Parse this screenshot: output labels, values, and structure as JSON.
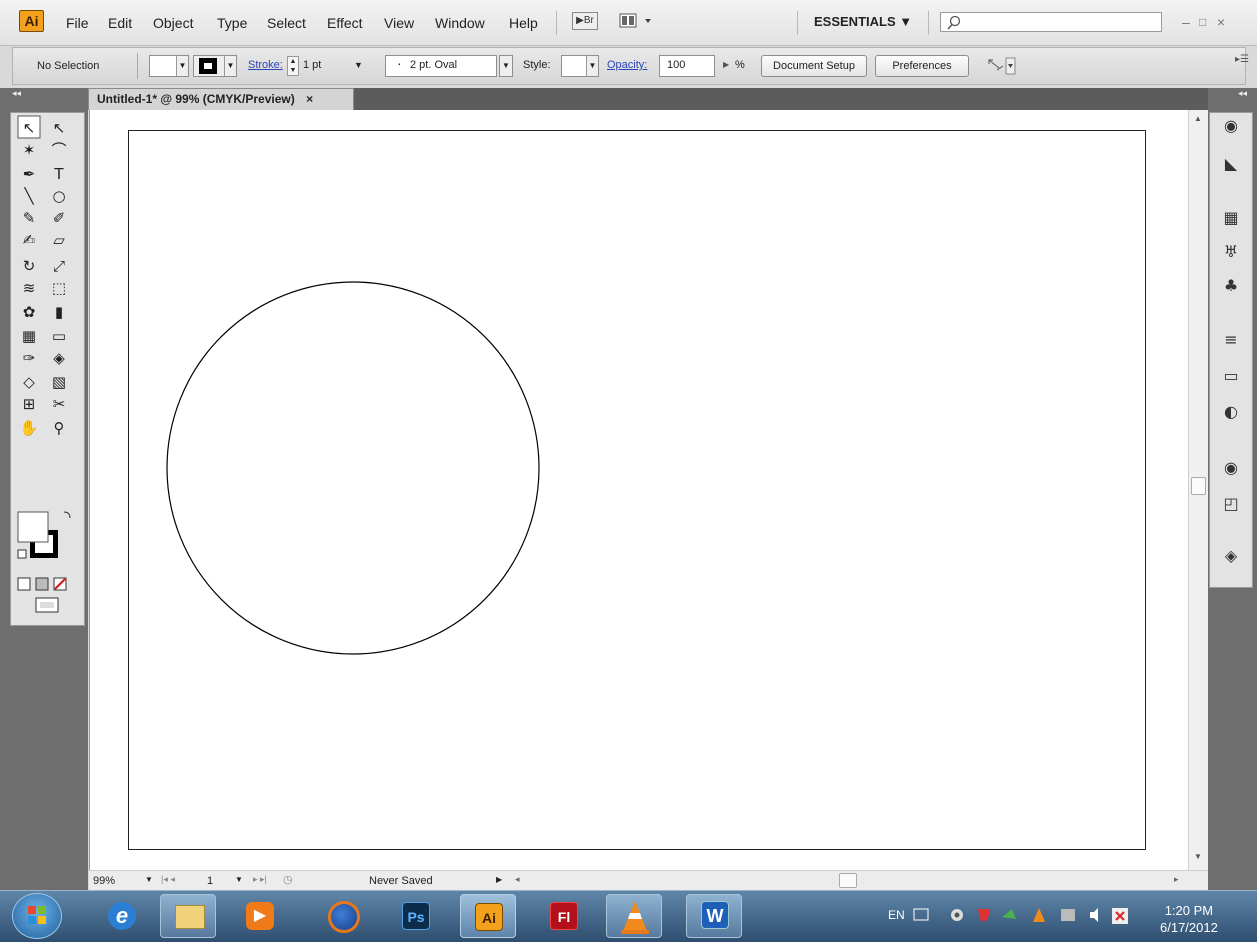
{
  "app": {
    "logo_text": "Ai",
    "accent": "#f3a11a"
  },
  "menu": [
    "File",
    "Edit",
    "Object",
    "Type",
    "Select",
    "Effect",
    "View",
    "Window",
    "Help"
  ],
  "menu_right": {
    "bridge_label": "Br",
    "workspace": "ESSENTIALS ▼",
    "search_placeholder": ""
  },
  "window_controls": {
    "minimize": "–",
    "restore": "□",
    "close": "×"
  },
  "control_bar": {
    "selection": "No Selection",
    "stroke_label": "Stroke:",
    "stroke_value": "1 pt",
    "brush": "2 pt. Oval",
    "style_label": "Style:",
    "opacity_label": "Opacity:",
    "opacity_value": "100",
    "percent": "%",
    "document_setup": "Document Setup",
    "preferences": "Preferences"
  },
  "document_tab": {
    "title": "Untitled-1* @ 99% (CMYK/Preview)",
    "close": "×"
  },
  "status_bar": {
    "zoom": "99%",
    "artboard": "1",
    "status": "Never Saved"
  },
  "tools": [
    "selection-tool-icon",
    "direct-selection-tool-icon",
    "magic-wand-tool-icon",
    "lasso-tool-icon",
    "pen-tool-icon",
    "type-tool-icon",
    "line-tool-icon",
    "ellipse-tool-icon",
    "paintbrush-tool-icon",
    "pencil-tool-icon",
    "blob-brush-tool-icon",
    "eraser-tool-icon",
    "rotate-tool-icon",
    "scale-tool-icon",
    "warp-tool-icon",
    "free-transform-tool-icon",
    "symbol-sprayer-tool-icon",
    "column-graph-tool-icon",
    "mesh-tool-icon",
    "gradient-tool-icon",
    "eyedropper-tool-icon",
    "blend-tool-icon",
    "live-paint-bucket-tool-icon",
    "live-paint-selection-tool-icon",
    "artboard-tool-icon",
    "slice-tool-icon",
    "hand-tool-icon",
    "zoom-tool-icon"
  ],
  "right_panel_icons": [
    "color-panel-icon",
    "color-guide-panel-icon",
    "swatches-panel-icon",
    "brushes-panel-icon",
    "symbols-panel-icon",
    "stroke-panel-icon",
    "gradient-panel-icon",
    "transparency-panel-icon",
    "appearance-panel-icon",
    "graphic-styles-panel-icon",
    "layers-panel-icon"
  ],
  "taskbar": {
    "apps": [
      "start-button",
      "internet-explorer",
      "windows-explorer",
      "media-player",
      "firefox",
      "photoshop",
      "illustrator",
      "flash",
      "vlc",
      "word"
    ],
    "ps_label": "Ps",
    "ai_label": "Ai",
    "fl_label": "Fl",
    "w_label": "W",
    "language": "EN",
    "time": "1:20 PM",
    "date": "6/17/2012"
  }
}
